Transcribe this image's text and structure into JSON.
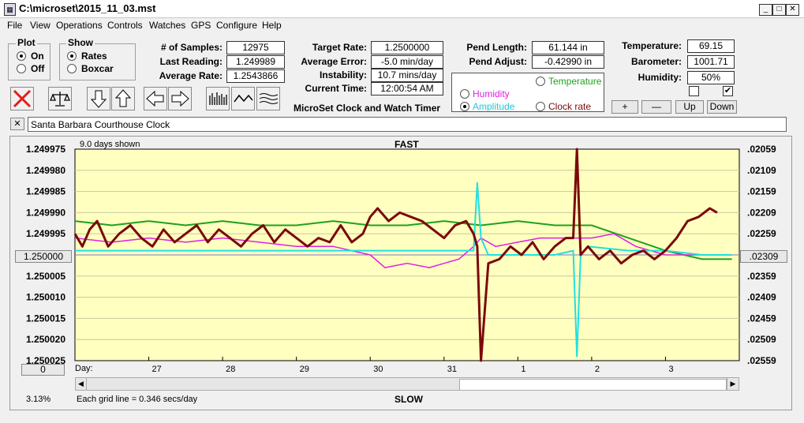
{
  "window": {
    "title": "C:\\microset\\2015_11_03.mst",
    "min": "_",
    "max": "□",
    "close": "✕"
  },
  "menu": [
    "File",
    "View",
    "Operations",
    "Controls",
    "Watches",
    "GPS",
    "Configure",
    "Help"
  ],
  "plot_group": {
    "title": "Plot",
    "options": [
      "On",
      "Off"
    ],
    "selected": "On"
  },
  "show_group": {
    "title": "Show",
    "options": [
      "Rates",
      "Boxcar"
    ],
    "selected": "Rates"
  },
  "stats": {
    "samples_label": "# of Samples:",
    "samples": "12975",
    "last_label": "Last Reading:",
    "last": "1.249989",
    "avg_rate_label": "Average Rate:",
    "avg_rate": "1.2543866",
    "target_label": "Target Rate:",
    "target": "1.2500000",
    "avg_err_label": "Average Error:",
    "avg_err": "-5.0 min/day",
    "instab_label": "Instability:",
    "instab": "10.7 mins/day",
    "time_label": "Current Time:",
    "time": "12:00:54 AM",
    "pend_len_label": "Pend Length:",
    "pend_len": "61.144 in",
    "pend_adj_label": "Pend Adjust:",
    "pend_adj": "-0.42990 in",
    "temp_label": "Temperature:",
    "temp": "69.15",
    "baro_label": "Barometer:",
    "baro": "1001.71",
    "hum_label": "Humidity:",
    "hum": "50%"
  },
  "subtitle": "MicroSet Clock and Watch Timer",
  "traces": {
    "temperature": "Temperature",
    "humidity": "Humidity",
    "amplitude": "Amplitude",
    "clock_rate": "Clock rate",
    "selected": "Amplitude"
  },
  "adjust_buttons": {
    "plus": "+",
    "minus": "—",
    "up": "Up",
    "down": "Down"
  },
  "checkboxes": [
    {
      "checked": false
    },
    {
      "checked": true
    }
  ],
  "close_x": "✕",
  "clock_name": "Santa Barbara Courthouse Clock",
  "colors": {
    "chart_bg": "#ffffc0",
    "rate": "#7a0a0a",
    "temperature": "#1fa01f",
    "humidity": "#e020e0",
    "amplitude": "#20e0e0",
    "baseline": "#7878c8"
  },
  "chart_header": {
    "days_shown": "9.0 days shown",
    "fast": "FAST",
    "slow": "SLOW",
    "grid_note": "Each grid line = 0.346 secs/day",
    "percent": "3.13%",
    "day_label": "Day:",
    "left_button": "1.250000",
    "right_button": ".02309",
    "zero_button": "0"
  },
  "chart_data": {
    "type": "line",
    "y_left_ticks": [
      "1.249975",
      "1.249980",
      "1.249985",
      "1.249990",
      "1.249995",
      "1.250000",
      "1.250005",
      "1.250010",
      "1.250015",
      "1.250020",
      "1.250025"
    ],
    "y_right_ticks": [
      ".02059",
      ".02109",
      ".02159",
      ".02209",
      ".02259",
      ".02309",
      ".02359",
      ".02409",
      ".02459",
      ".02509",
      ".02559"
    ],
    "x_ticks": [
      "27",
      "28",
      "29",
      "30",
      "31",
      "1",
      "2",
      "3"
    ],
    "ylim": [
      1.249975,
      1.250025
    ],
    "xlim": [
      0,
      9
    ],
    "series": [
      {
        "name": "Clock rate",
        "x": [
          0,
          0.1,
          0.2,
          0.3,
          0.45,
          0.6,
          0.75,
          0.9,
          1.05,
          1.2,
          1.35,
          1.5,
          1.65,
          1.8,
          1.95,
          2.1,
          2.25,
          2.4,
          2.55,
          2.7,
          2.85,
          3.0,
          3.15,
          3.3,
          3.45,
          3.6,
          3.75,
          3.9,
          4.0,
          4.1,
          4.25,
          4.4,
          4.55,
          4.7,
          4.85,
          5.0,
          5.15,
          5.3,
          5.4,
          5.45,
          5.5,
          5.6,
          5.75,
          5.9,
          6.05,
          6.2,
          6.35,
          6.5,
          6.65,
          6.75,
          6.8,
          6.85,
          6.95,
          7.1,
          7.25,
          7.4,
          7.55,
          7.7,
          7.85,
          8.0,
          8.15,
          8.3,
          8.45,
          8.6,
          8.7
        ],
        "values": [
          1.249995,
          1.249998,
          1.249994,
          1.249992,
          1.249998,
          1.249995,
          1.249993,
          1.249996,
          1.249998,
          1.249994,
          1.249997,
          1.249995,
          1.249993,
          1.249997,
          1.249994,
          1.249996,
          1.249998,
          1.249995,
          1.249993,
          1.249997,
          1.249994,
          1.249996,
          1.249998,
          1.249996,
          1.249997,
          1.249993,
          1.249997,
          1.249995,
          1.249991,
          1.249989,
          1.249992,
          1.24999,
          1.249991,
          1.249992,
          1.249994,
          1.249996,
          1.249993,
          1.249992,
          1.249995,
          1.249998,
          1.250025,
          1.250002,
          1.250001,
          1.249998,
          1.25,
          1.249997,
          1.250001,
          1.249998,
          1.249996,
          1.249996,
          1.249975,
          1.25,
          1.249998,
          1.250001,
          1.249999,
          1.250002,
          1.25,
          1.249999,
          1.250001,
          1.249999,
          1.249996,
          1.249992,
          1.249991,
          1.249989,
          1.24999
        ]
      },
      {
        "name": "Temperature",
        "x": [
          0,
          0.5,
          1,
          1.5,
          2,
          2.5,
          3,
          3.5,
          4,
          4.5,
          5,
          5.5,
          6,
          6.5,
          7,
          7.5,
          8,
          8.5,
          8.9
        ],
        "values": [
          1.249992,
          1.249993,
          1.249992,
          1.249993,
          1.249992,
          1.249993,
          1.249993,
          1.249992,
          1.249993,
          1.249993,
          1.249992,
          1.249993,
          1.249992,
          1.249993,
          1.249993,
          1.249996,
          1.249999,
          1.250001,
          1.250001
        ]
      },
      {
        "name": "Humidity",
        "x": [
          0,
          0.5,
          1,
          1.5,
          2,
          2.5,
          3,
          3.5,
          4,
          4.2,
          4.5,
          4.8,
          5,
          5.2,
          5.4,
          5.5,
          5.7,
          6,
          6.3,
          6.6,
          7,
          7.3,
          7.6,
          8,
          8.4,
          8.9
        ],
        "values": [
          1.249996,
          1.249997,
          1.249996,
          1.249997,
          1.249996,
          1.249997,
          1.249998,
          1.249998,
          1.25,
          1.250003,
          1.250002,
          1.250003,
          1.250002,
          1.250001,
          1.249998,
          1.249996,
          1.249998,
          1.249997,
          1.249996,
          1.249996,
          1.249996,
          1.249995,
          1.249998,
          1.25,
          1.25,
          1.25
        ]
      },
      {
        "name": "Amplitude",
        "x": [
          0,
          1,
          2,
          3,
          4,
          5,
          5.4,
          5.45,
          5.5,
          5.6,
          6,
          6.5,
          6.75,
          6.8,
          6.85,
          6.95,
          7.5,
          8,
          8.5,
          8.9
        ],
        "values": [
          1.249999,
          1.249999,
          1.249999,
          1.249999,
          1.249999,
          1.249999,
          1.249999,
          1.249983,
          1.249996,
          1.25,
          1.25,
          1.25,
          1.249999,
          1.250024,
          1.25,
          1.249998,
          1.249999,
          1.249999,
          1.25,
          1.25
        ]
      }
    ]
  }
}
